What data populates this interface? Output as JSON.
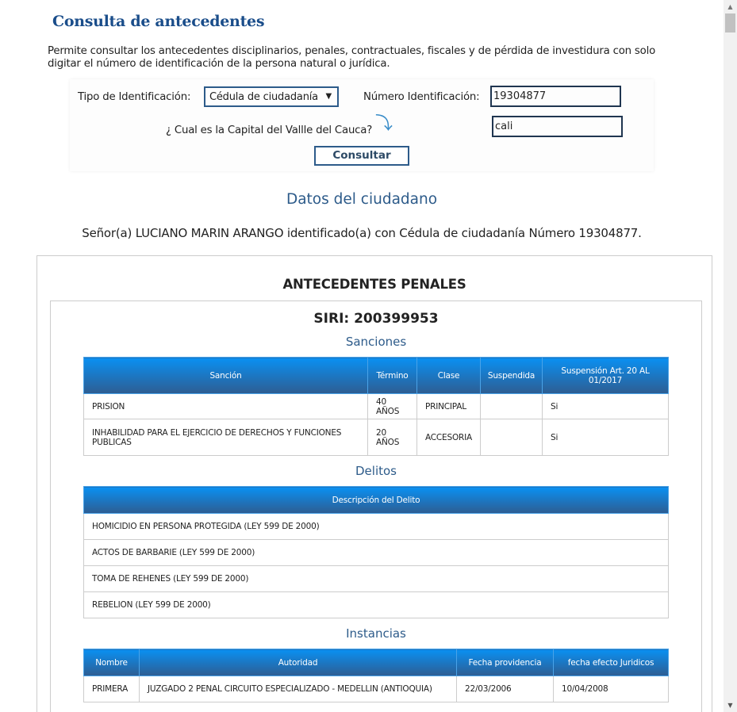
{
  "title": "Consulta de antecedentes",
  "intro": "Permite consultar los antecedentes disciplinarios, penales, contractuales, fiscales y de pérdida de investidura con solo digitar el número de identificación de la persona natural o jurídica.",
  "form": {
    "tipo_label": "Tipo de Identificación:",
    "tipo_value": "Cédula de ciudadanía",
    "numero_label": "Número Identificación:",
    "numero_value": "19304877",
    "question": "¿ Cual es la Capital del Vallle del Cauca?",
    "answer": "cali",
    "submit": "Consultar"
  },
  "datos_title": "Datos del ciudadano",
  "person": "Señor(a)  LUCIANO  MARIN ARANGO identificado(a) con Cédula de ciudadanía Número 19304877.",
  "section_title": "ANTECEDENTES PENALES",
  "siri": "SIRI: 200399953",
  "sanciones": {
    "title": "Sanciones",
    "headers": [
      "Sanción",
      "Término",
      "Clase",
      "Suspendida",
      "Suspensión Art. 20 AL 01/2017"
    ],
    "rows": [
      [
        "PRISION",
        "40 AÑOS",
        "PRINCIPAL",
        "",
        "Si"
      ],
      [
        "INHABILIDAD PARA EL EJERCICIO DE DERECHOS Y FUNCIONES PUBLICAS",
        "20 AÑOS",
        "ACCESORIA",
        "",
        "Si"
      ]
    ]
  },
  "delitos": {
    "title": "Delitos",
    "header": "Descripción del Delito",
    "rows": [
      "HOMICIDIO EN PERSONA PROTEGIDA (LEY 599 DE 2000)",
      "ACTOS DE BARBARIE (LEY 599 DE 2000)",
      "TOMA DE REHENES (LEY 599 DE 2000)",
      "REBELION (LEY 599 DE 2000)"
    ]
  },
  "instancias": {
    "title": "Instancias",
    "headers": [
      "Nombre",
      "Autoridad",
      "Fecha providencia",
      "fecha efecto Juridicos"
    ],
    "rows": [
      [
        "PRIMERA",
        "JUZGADO 2 PENAL CIRCUITO ESPECIALIZADO - MEDELLIN (ANTIOQUIA)",
        "22/03/2006",
        "10/04/2008"
      ]
    ]
  }
}
